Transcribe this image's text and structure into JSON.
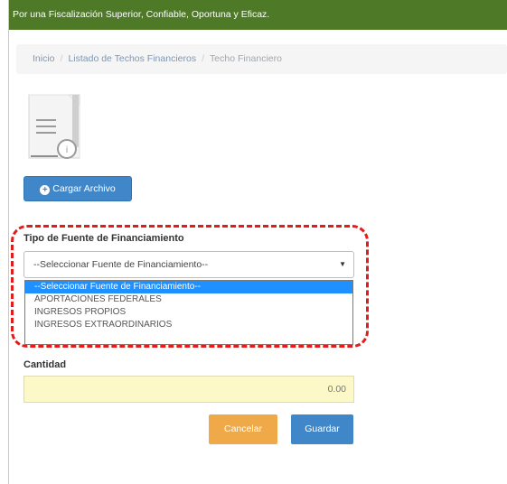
{
  "header": {
    "banner_text": "Por una Fiscalización Superior, Confiable, Oportuna y Eficaz."
  },
  "breadcrumb": {
    "items": [
      "Inicio",
      "Listado de Techos Financieros",
      "Techo Financiero"
    ]
  },
  "upload": {
    "button_label": "Cargar Archivo",
    "icon": "document-file-icon"
  },
  "form": {
    "fuente_label": "Tipo de Fuente de Financiamiento",
    "fuente_selected": "--Seleccionar Fuente de Financiamiento--",
    "fuente_options": [
      "--Seleccionar Fuente de Financiamiento--",
      "APORTACIONES FEDERALES",
      "INGRESOS PROPIOS",
      "INGRESOS EXTRAORDINARIOS"
    ],
    "cantidad_label": "Cantidad",
    "cantidad_value": "0.00"
  },
  "actions": {
    "cancel_label": "Cancelar",
    "save_label": "Guardar"
  },
  "colors": {
    "banner": "#4e7a27",
    "primary": "#3f87c9",
    "cancel": "#f0a948",
    "highlight": "#e31b1b",
    "selected_option": "#1e90ff",
    "amount_bg": "#fcf8c8"
  }
}
